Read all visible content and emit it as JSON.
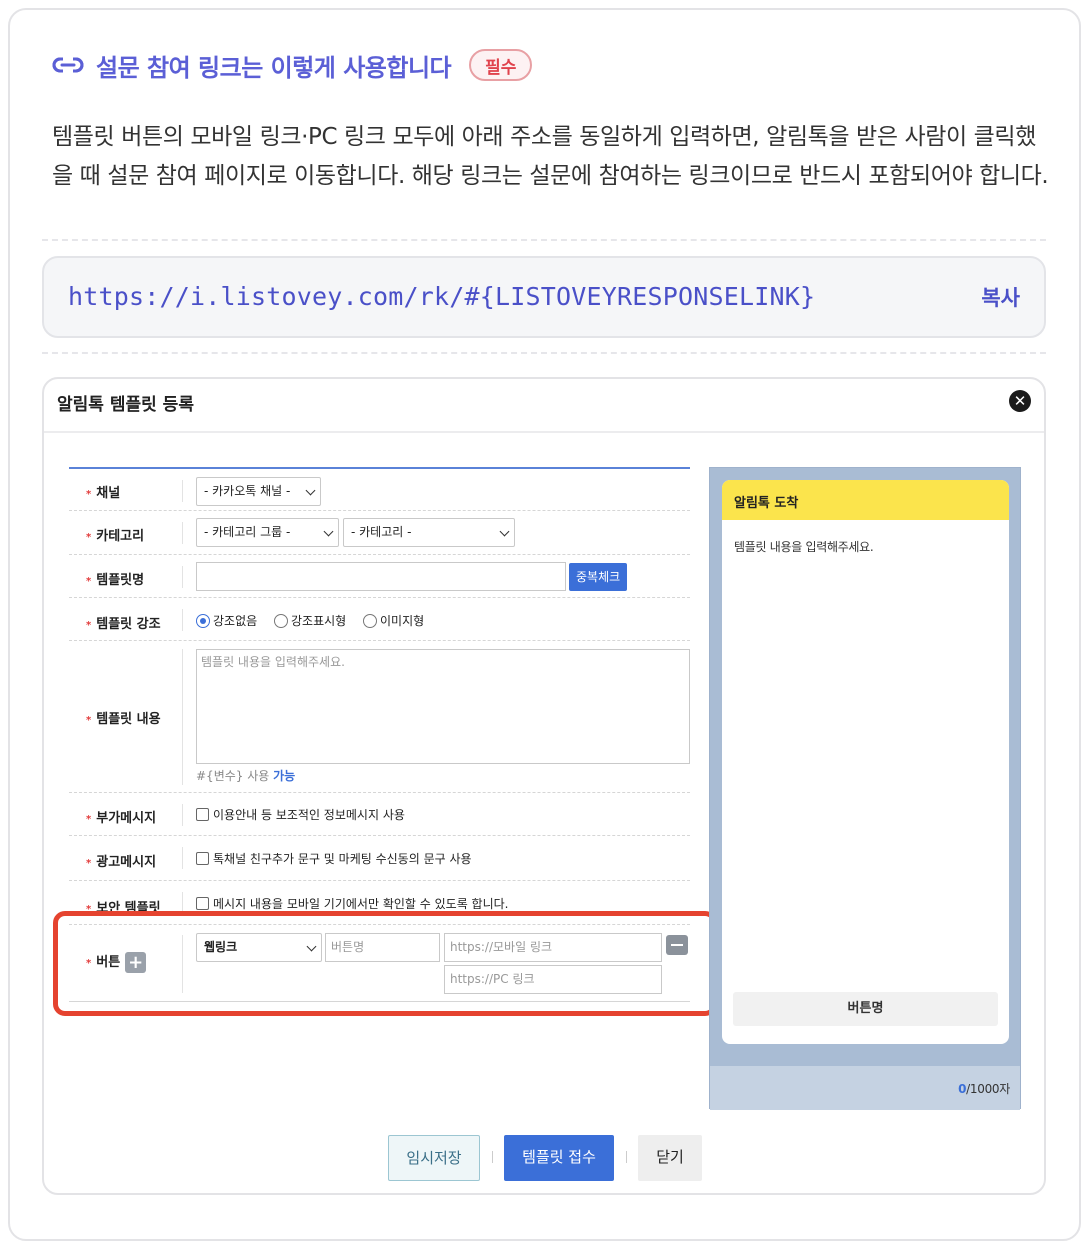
{
  "guide": {
    "title": "설문 참여 링크는 이렇게 사용합니다",
    "badge": "필수",
    "description": "템플릿 버튼의 모바일 링크·PC 링크 모두에 아래 주소를 동일하게 입력하면, 알림톡을 받은 사람이 클릭했을 때 설문 참여 페이지로 이동합니다. 해당 링크는 설문에 참여하는 링크이므로 반드시 포함되어야 합니다.",
    "url": "https://i.listovey.com/rk/#{LISTOVEYRESPONSELINK}",
    "copy_label": "복사"
  },
  "modal": {
    "title": "알림톡 템플릿 등록",
    "close_icon": "close-x",
    "rows": {
      "channel": {
        "label": "채널",
        "select": "- 카카오톡 채널 -"
      },
      "category": {
        "label": "카테고리",
        "group_select": "- 카테고리 그룹 -",
        "select": "- 카테고리 -"
      },
      "name": {
        "label": "템플릿명",
        "dup_check": "중복체크"
      },
      "emphasis": {
        "label": "템플릿 강조",
        "options": [
          "강조없음",
          "강조표시형",
          "이미지형"
        ],
        "selected": "강조없음"
      },
      "content": {
        "label": "템플릿 내용",
        "placeholder": "템플릿 내용을 입력해주세요.",
        "hint_prefix": "#{변수} 사용",
        "hint_link": "가능"
      },
      "extra": {
        "label": "부가메시지",
        "checkbox": "이용안내 등 보조적인 정보메시지 사용"
      },
      "ad": {
        "label": "광고메시지",
        "checkbox": "톡채널 친구추가 문구 및 마케팅 수신동의 문구 사용"
      },
      "secure": {
        "label": "보안 템플릿",
        "checkbox": "메시지 내용을 모바일 기기에서만 확인할 수 있도록 합니다."
      },
      "button": {
        "label": "버튼",
        "type_select": "웹링크",
        "name_placeholder": "버튼명",
        "mobile_placeholder": "https://모바일 링크",
        "pc_placeholder": "https://PC 링크"
      }
    },
    "preview": {
      "header": "알림톡 도착",
      "body": "템플릿 내용을 입력해주세요.",
      "button": "버튼명",
      "count_current": "0",
      "count_total": "/1000자"
    },
    "footer": {
      "temp_save": "임시저장",
      "submit": "템플릿 접수",
      "close": "닫기"
    }
  },
  "colors": {
    "accent": "#5b5fd6",
    "highlight": "#e5432f",
    "primary_button": "#3b6fd8",
    "kakao_yellow": "#fbe44c"
  }
}
